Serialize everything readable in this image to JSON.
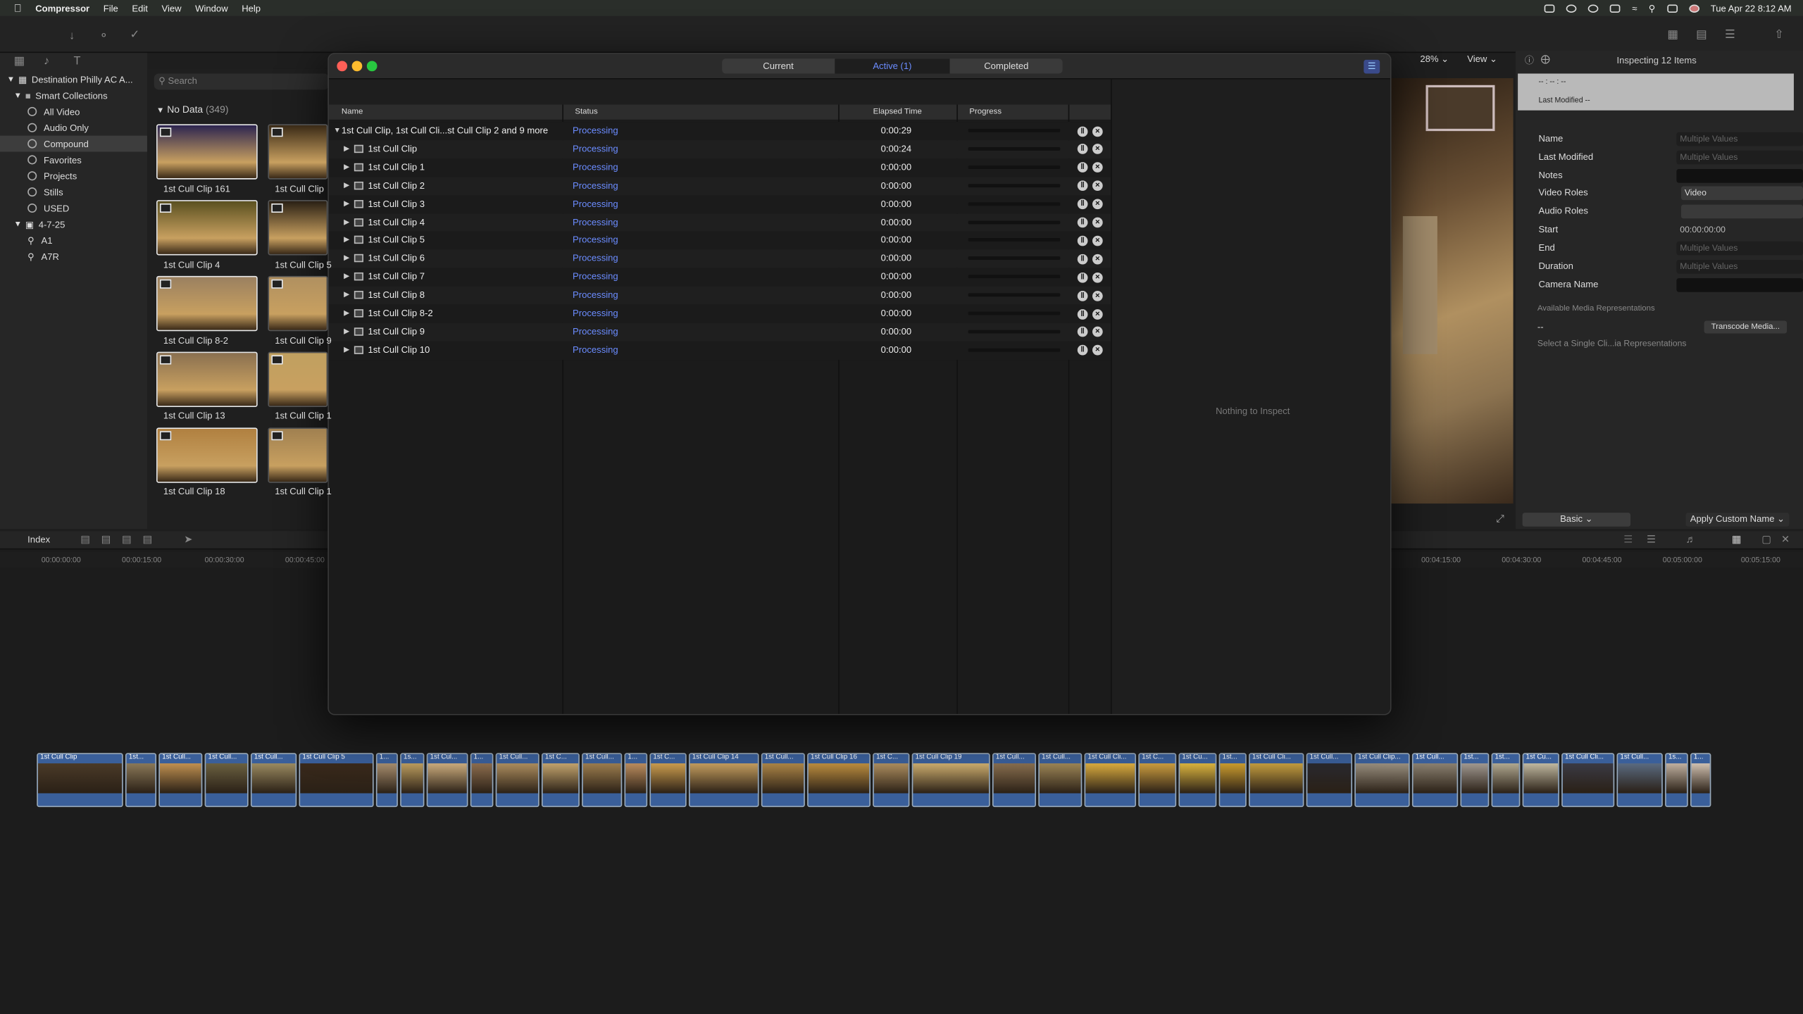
{
  "menubar": {
    "app": "Compressor",
    "items": [
      "File",
      "Edit",
      "View",
      "Window",
      "Help"
    ],
    "datetime": "Tue Apr 22  8:12 AM"
  },
  "sidebar": {
    "library": "Destination Philly  AC A...",
    "smart_collections": "Smart Collections",
    "items": [
      "All Video",
      "Audio Only",
      "Compound",
      "Favorites",
      "Projects",
      "Stills",
      "USED"
    ],
    "event": "4-7-25",
    "keywords": [
      "A1",
      "A7R"
    ]
  },
  "browser": {
    "search_placeholder": "Search",
    "group_title": "No Data",
    "group_count": "(349)",
    "clips": [
      {
        "label": "1st Cull Clip 161",
        "color": "#2d2550"
      },
      {
        "label": "1st Cull Clip",
        "color": "#3a2a16"
      },
      {
        "label": "1st Cull Clip 4",
        "color": "#5a5020"
      },
      {
        "label": "1st Cull Clip 5",
        "color": "#2a2014"
      },
      {
        "label": "1st Cull Clip 8-2",
        "color": "#9a8060"
      },
      {
        "label": "1st Cull Clip 9",
        "color": "#b09060"
      },
      {
        "label": "1st Cull Clip 13",
        "color": "#8a7050"
      },
      {
        "label": "1st Cull Clip 1",
        "color": "#c0a060"
      },
      {
        "label": "1st Cull Clip 18",
        "color": "#b08040"
      },
      {
        "label": "1st Cull Clip 1",
        "color": "#a08050"
      }
    ]
  },
  "compressor": {
    "tabs": {
      "current": "Current",
      "active": "Active (1)",
      "completed": "Completed"
    },
    "columns": {
      "name": "Name",
      "status": "Status",
      "elapsed": "Elapsed Time",
      "progress": "Progress"
    },
    "batch": {
      "name": "1st Cull Clip, 1st Cull Cli...st Cull Clip 2 and 9 more",
      "status": "Processing",
      "elapsed": "0:00:29"
    },
    "jobs": [
      {
        "name": "1st Cull Clip",
        "status": "Processing",
        "elapsed": "0:00:24"
      },
      {
        "name": "1st Cull Clip 1",
        "status": "Processing",
        "elapsed": "0:00:00"
      },
      {
        "name": "1st Cull Clip 2",
        "status": "Processing",
        "elapsed": "0:00:00"
      },
      {
        "name": "1st Cull Clip 3",
        "status": "Processing",
        "elapsed": "0:00:00"
      },
      {
        "name": "1st Cull Clip 4",
        "status": "Processing",
        "elapsed": "0:00:00"
      },
      {
        "name": "1st Cull Clip 5",
        "status": "Processing",
        "elapsed": "0:00:00"
      },
      {
        "name": "1st Cull Clip 6",
        "status": "Processing",
        "elapsed": "0:00:00"
      },
      {
        "name": "1st Cull Clip 7",
        "status": "Processing",
        "elapsed": "0:00:00"
      },
      {
        "name": "1st Cull Clip 8",
        "status": "Processing",
        "elapsed": "0:00:00"
      },
      {
        "name": "1st Cull Clip 8-2",
        "status": "Processing",
        "elapsed": "0:00:00"
      },
      {
        "name": "1st Cull Clip 9",
        "status": "Processing",
        "elapsed": "0:00:00"
      },
      {
        "name": "1st Cull Clip 10",
        "status": "Processing",
        "elapsed": "0:00:00"
      }
    ],
    "inspect_empty": "Nothing to Inspect"
  },
  "viewer": {
    "zoom": "28%",
    "view": "View"
  },
  "inspector": {
    "title": "Inspecting 12 Items",
    "summary_range": "-- : -- : --",
    "summary_modified": "Last Modified --",
    "fields": [
      {
        "label": "Name",
        "value": "Multiple Values"
      },
      {
        "label": "Last Modified",
        "value": "Multiple Values"
      },
      {
        "label": "Notes",
        "value": ""
      },
      {
        "label": "Video Roles",
        "value": "Video"
      },
      {
        "label": "Audio Roles",
        "value": ""
      },
      {
        "label": "Start",
        "value": "00:00:00:00"
      },
      {
        "label": "End",
        "value": "Multiple Values"
      },
      {
        "label": "Duration",
        "value": "Multiple Values"
      },
      {
        "label": "Camera Name",
        "value": ""
      }
    ],
    "media_reps_title": "Available Media Representations",
    "media_reps_value": "--",
    "transcode_btn": "Transcode Media...",
    "media_reps_hint": "Select a Single Cli...ia Representations",
    "basic": "Basic",
    "apply_name": "Apply Custom Name"
  },
  "timeline": {
    "index": "Index",
    "ruler_left": [
      "00:00:00:00",
      "00:00:15:00",
      "00:00:30:00",
      "00:00:45:00"
    ],
    "ruler_right": [
      "00:04:15:00",
      "00:04:30:00",
      "00:04:45:00",
      "00:05:00:00",
      "00:05:15:00"
    ],
    "clips": [
      "1st Cull Clip",
      "1st...",
      "1st Cull...",
      "1st Cull...",
      "1st Cull...",
      "1st Cull Clip 5",
      "1...",
      "1s...",
      "1st Cul...",
      "1...",
      "1st Cull...",
      "1st C...",
      "1st Cull...",
      "1...",
      "1st C...",
      "1st Cull Clip 14",
      "1st Cull...",
      "1st Cull Clip 16",
      "1st C...",
      "1st Cull Clip 19",
      "1st Cull...",
      "1st Cull...",
      "1st Cull Cli...",
      "1st C...",
      "1st Cu...",
      "1st...",
      "1st Cull Cli...",
      "1st Cull...",
      "1st Cull Clip...",
      "1st Cull...",
      "1st...",
      "1st...",
      "1st Cu...",
      "1st Cull Cli...",
      "1st Cull...",
      "1s...",
      "1..."
    ]
  }
}
